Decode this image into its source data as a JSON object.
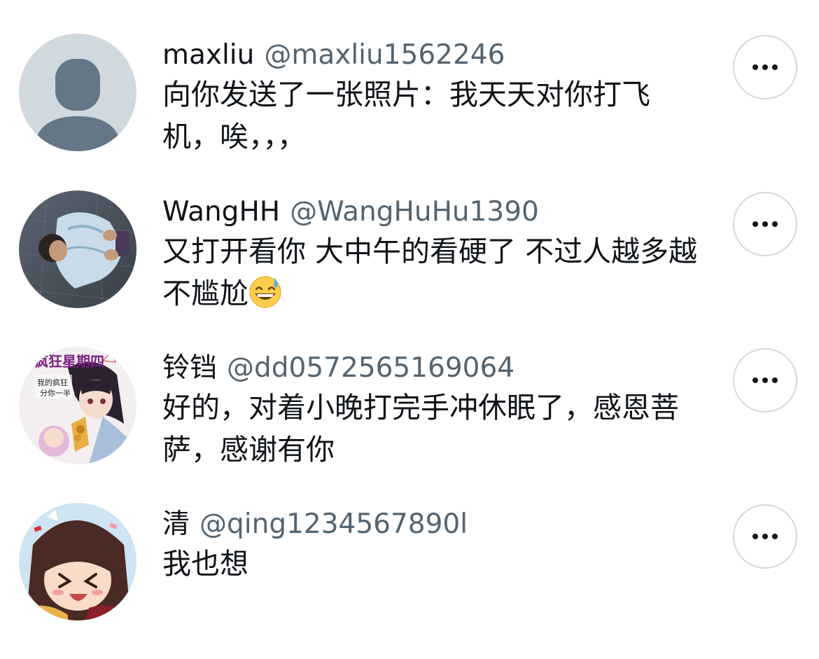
{
  "messages": [
    {
      "display_name": "maxliu",
      "handle": "@maxliu1562246",
      "text": "向你发送了一张照片：我天天对你打飞机，唉，，，",
      "avatar": "default-avatar-icon",
      "emoji": ""
    },
    {
      "display_name": "WangHH",
      "handle": "@WangHuHu1390",
      "text": "又打开看你 大中午的看硬了 不过人越多越不尴尬",
      "avatar": "photo-avatar",
      "emoji": "😅"
    },
    {
      "display_name": "铃铛",
      "handle": "@dd0572565169064",
      "text": "好的，对着小晚打完手冲休眠了，感恩菩萨，感谢有你",
      "avatar": "anime-avatar",
      "avatar_text": "疯狂星期四",
      "avatar_subtext": "我的疯狂",
      "avatar_subtext2": "分你一半",
      "emoji": ""
    },
    {
      "display_name": "清",
      "handle": "@qing1234567890l",
      "text": "我也想",
      "avatar": "anime-avatar",
      "emoji": ""
    }
  ],
  "more_icon": "more-options-icon",
  "colors": {
    "name": "#0f1419",
    "handle": "#536471",
    "border": "#cfd9de",
    "default_avatar_bg": "#cfd9de",
    "default_avatar_fg": "#657786"
  }
}
